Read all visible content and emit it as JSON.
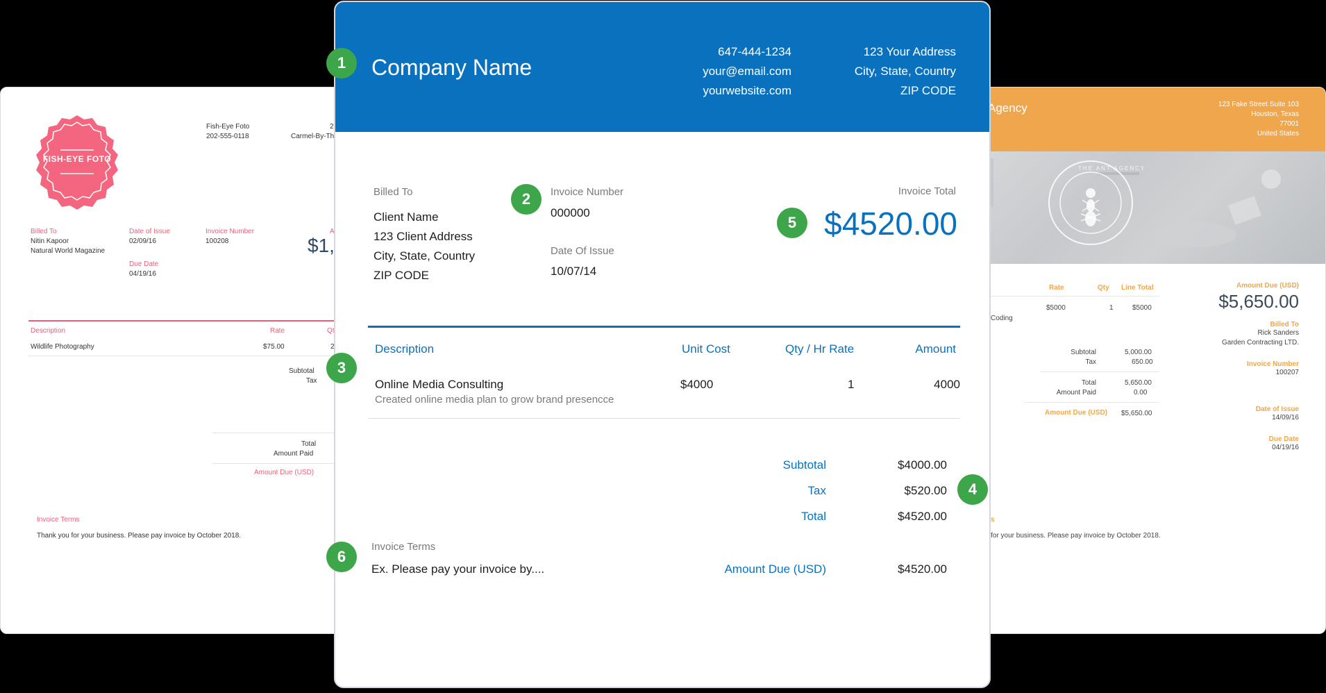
{
  "left_invoice": {
    "badge_text": "FISH-EYE FOTO",
    "company": "Fish-Eye Foto",
    "phone": "202-555-0118",
    "address_fragment_1": "2",
    "address_fragment_2": "Carmel-By-Th",
    "billed_to_label": "Billed To",
    "client_name": "Nitin Kapoor",
    "client_company": "Natural World Magazine",
    "date_of_issue_label": "Date of Issue",
    "date_of_issue": "02/09/16",
    "due_date_label": "Due Date",
    "due_date": "04/19/16",
    "invoice_number_label": "Invoice Number",
    "invoice_number": "100208",
    "amount_fragment_label": "A",
    "amount_fragment": "$1,",
    "description_label": "Description",
    "rate_label": "Rate",
    "qty_fragment_label": "Qt",
    "item_description": "Wildlife Photography",
    "item_rate": "$75.00",
    "item_qty_fragment": "2",
    "subtotal_label": "Subtotal",
    "tax_label": "Tax",
    "total_label": "Total",
    "amount_paid_label": "Amount Paid",
    "amount_due_label": "Amount Due (USD)",
    "terms_label": "Invoice Terms",
    "terms_text": "Thank you for your business. Please pay invoice by October 2018.",
    "accent_color": "#f05d7a"
  },
  "right_invoice": {
    "company_fragment": "Agency",
    "address_line_1": "123 Fake Street Suite 103",
    "address_line_2": "Houston, Texas",
    "address_line_3": "77001",
    "address_line_4": "United States",
    "logo_top_text": "THE ANT AGENCY",
    "rate_label": "Rate",
    "qty_label": "Qty",
    "line_total_label": "Line Total",
    "item_rate": "$5000",
    "item_qty": "1",
    "item_line_total": "$5000",
    "item_description_fragment": "Coding",
    "subtotal_label": "Subtotal",
    "subtotal_value": "5,000.00",
    "tax_label": "Tax",
    "tax_value": "650.00",
    "total_label": "Total",
    "total_value": "5,650.00",
    "amount_paid_label": "Amount Paid",
    "amount_paid_value": "0.00",
    "amount_due_label": "Amount Due (USD)",
    "amount_due_value": "$5,650.00",
    "amount_due_big_label": "Amount Due (USD)",
    "amount_due_big": "$5,650.00",
    "billed_to_label": "Billed To",
    "client_name": "Rick Sanders",
    "client_company": "Garden Contracting LTD.",
    "invoice_number_label": "Invoice Number",
    "invoice_number": "100207",
    "date_of_issue_label": "Date of Issue",
    "date_of_issue": "14/09/16",
    "due_date_label": "Due Date",
    "due_date": "04/19/16",
    "terms_fragment": "ns",
    "terms_text_fragment": "r for your business. Please pay invoice by October 2018.",
    "accent_color": "#f0a64c"
  },
  "center_invoice": {
    "company_name": "Company Name",
    "phone": "647-444-1234",
    "email": "your@email.com",
    "website": "yourwebsite.com",
    "address_line_1": "123 Your Address",
    "address_line_2": "City, State, Country",
    "address_line_3": "ZIP CODE",
    "billed_to_label": "Billed To",
    "client_name": "Client Name",
    "client_address": "123 Client Address",
    "client_city": "City, State, Country",
    "client_zip": "ZIP CODE",
    "invoice_number_label": "Invoice Number",
    "invoice_number": "000000",
    "date_of_issue_label": "Date Of Issue",
    "date_of_issue": "10/07/14",
    "invoice_total_label": "Invoice Total",
    "invoice_total": "$4520.00",
    "col_description": "Description",
    "col_unit_cost": "Unit Cost",
    "col_qty_rate": "Qty / Hr Rate",
    "col_amount": "Amount",
    "item_title": "Online Media Consulting",
    "item_subtitle": "Created online media plan to grow brand presencce",
    "item_unit_cost": "$4000",
    "item_qty": "1",
    "item_amount": "4000",
    "subtotal_label": "Subtotal",
    "subtotal_value": "$4000.00",
    "tax_label": "Tax",
    "tax_value": "$520.00",
    "total_label": "Total",
    "total_value": "$4520.00",
    "terms_label": "Invoice Terms",
    "terms_text": "Ex. Please pay your invoice by....",
    "amount_due_label": "Amount Due (USD)",
    "amount_due_value": "$4520.00",
    "header_color": "#0a71bf"
  },
  "markers": [
    "1",
    "2",
    "3",
    "4",
    "5",
    "6"
  ],
  "marker_color": "#3ea64a"
}
